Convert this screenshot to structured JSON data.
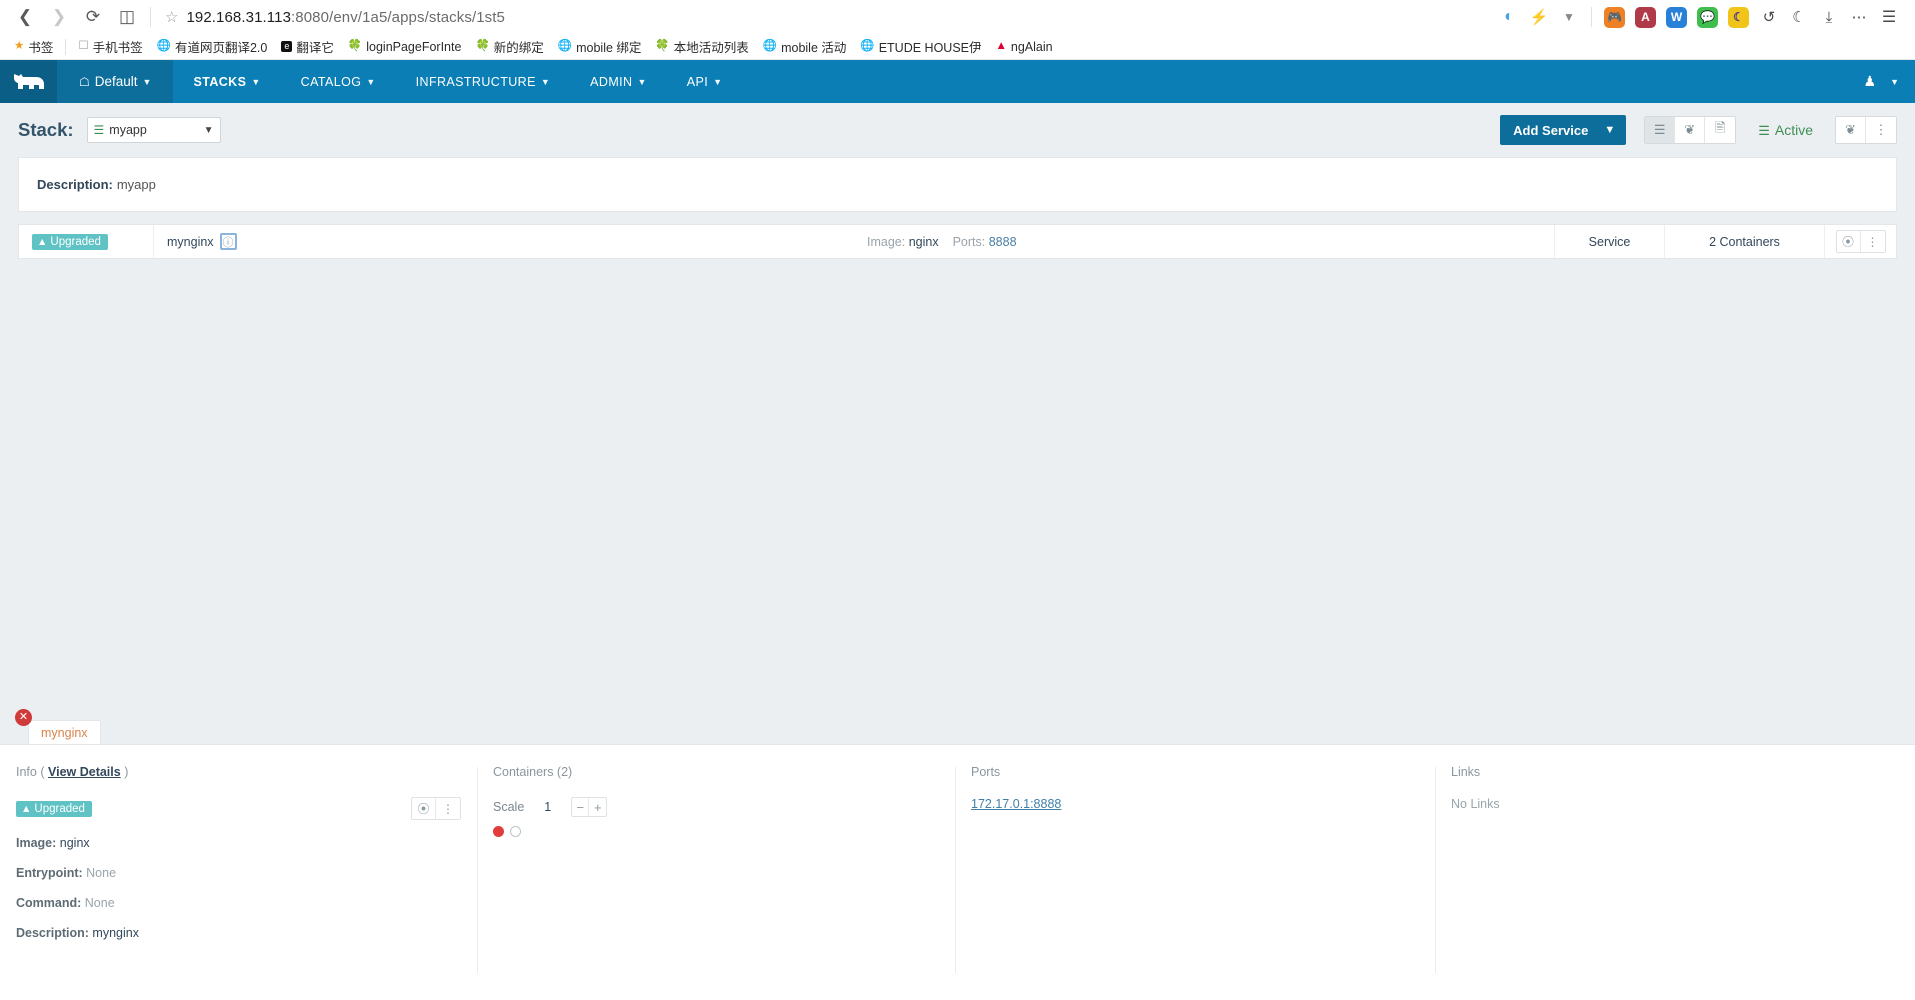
{
  "browser": {
    "nav": {
      "back_icon": "chevron-left",
      "forward_icon": "chevron-right",
      "reload_icon": "reload",
      "reader_icon": "book"
    },
    "url": {
      "host": "192.168.31.113",
      "rest": ":8080/env/1a5/apps/stacks/1st5",
      "star_icon": "star-outline"
    },
    "right_icons": [
      {
        "name": "sync-icon",
        "glyph": "◔",
        "color": "#4aa3df"
      },
      {
        "name": "lightning-icon",
        "glyph": "⚡",
        "color": "#555555"
      },
      {
        "name": "chevron-down-icon",
        "glyph": "⌄",
        "color": "#777777"
      },
      {
        "name": "gamepad-extension-icon",
        "glyph": "⬤",
        "color": "#ee8026",
        "label": ""
      },
      {
        "name": "adblock-extension-icon",
        "glyph": "A",
        "color": "#b03a48"
      },
      {
        "name": "youdao-extension-icon",
        "glyph": "W",
        "color": "#2980d9"
      },
      {
        "name": "wechat-extension-icon",
        "glyph": "●",
        "color": "#3fbe4d"
      },
      {
        "name": "moon-extension-icon",
        "glyph": "☾",
        "color": "#f0c418"
      },
      {
        "name": "undo-icon",
        "glyph": "↺",
        "color": "#444444"
      },
      {
        "name": "night-mode-icon",
        "glyph": "☾",
        "color": "#444444"
      },
      {
        "name": "download-icon",
        "glyph": "⤓",
        "color": "#444444"
      },
      {
        "name": "more-icon",
        "glyph": "⋯",
        "color": "#444444"
      },
      {
        "name": "menu-icon",
        "glyph": "☰",
        "color": "#444444"
      }
    ]
  },
  "bookmarks": [
    {
      "label": "书签",
      "icon": "star",
      "icon_class": "star"
    },
    {
      "label": "手机书签",
      "icon": "folder",
      "icon_class": "folder"
    },
    {
      "label": "有道网页翻译2.0",
      "icon": "globe",
      "icon_class": "globe"
    },
    {
      "label": "翻译它",
      "icon": "translate",
      "icon_class": "black"
    },
    {
      "label": "loginPageForInte",
      "icon": "leaf",
      "icon_class": "leaf"
    },
    {
      "label": "新的绑定",
      "icon": "leaf",
      "icon_class": "leaf"
    },
    {
      "label": "mobile 绑定",
      "icon": "globe",
      "icon_class": "globe"
    },
    {
      "label": "本地活动列表",
      "icon": "leaf",
      "icon_class": "leaf"
    },
    {
      "label": "mobile 活动",
      "icon": "globe",
      "icon_class": "globe"
    },
    {
      "label": "ETUDE HOUSE伊",
      "icon": "globe",
      "icon_class": "globe"
    },
    {
      "label": "ngAlain",
      "icon": "angular",
      "icon_class": "angular"
    }
  ],
  "rancher_nav": {
    "logo_name": "rancher-cow-logo",
    "environment": "Default",
    "items": [
      {
        "label": "STACKS",
        "active": true,
        "caret": true
      },
      {
        "label": "CATALOG",
        "active": false,
        "caret": true
      },
      {
        "label": "INFRASTRUCTURE",
        "active": false,
        "caret": true
      },
      {
        "label": "ADMIN",
        "active": false,
        "caret": true
      },
      {
        "label": "API",
        "active": false,
        "caret": true
      }
    ],
    "user_icon": "user-icon",
    "user_caret": "chevron-down-icon"
  },
  "stack_header": {
    "label": "Stack:",
    "selected_stack": "myapp",
    "add_service_label": "Add Service",
    "view_buttons": [
      {
        "name": "list-view-button",
        "glyph": "☰",
        "selected": true
      },
      {
        "name": "graph-view-button",
        "glyph": "⪤",
        "selected": false
      },
      {
        "name": "config-view-button",
        "glyph": "☷",
        "selected": false
      }
    ],
    "state_label": "Active",
    "right_buttons": [
      {
        "name": "share-button",
        "glyph": "⪤"
      },
      {
        "name": "overflow-menu-button",
        "glyph": "⋮"
      }
    ]
  },
  "description_card": {
    "label": "Description:",
    "value": "myapp"
  },
  "service_row": {
    "state_badge": "Upgraded",
    "name": "mynginx",
    "info_icon": "info-icon",
    "image_label": "Image:",
    "image_value": "nginx",
    "ports_label": "Ports:",
    "ports_value": "8888",
    "type": "Service",
    "containers": "2 Containers",
    "actions": [
      {
        "name": "activate-button",
        "glyph": "⊘"
      },
      {
        "name": "row-menu-button",
        "glyph": "⋮"
      }
    ]
  },
  "detail_panel": {
    "tab_label": "mynginx",
    "close_icon": "close-icon",
    "info": {
      "title_prefix": "Info (",
      "title_link": "View Details",
      "title_suffix": ")",
      "badge": "Upgraded",
      "actions": [
        {
          "name": "activate-button",
          "glyph": "⊘"
        },
        {
          "name": "detail-menu-button",
          "glyph": "⋮"
        }
      ],
      "rows": [
        {
          "label": "Image:",
          "value": "nginx"
        },
        {
          "label": "Entrypoint:",
          "value": "None"
        },
        {
          "label": "Command:",
          "value": "None"
        },
        {
          "label": "Description:",
          "value": "mynginx"
        }
      ]
    },
    "containers": {
      "title": "Containers (2)",
      "scale_label": "Scale",
      "scale_value": "1",
      "minus": "−",
      "plus": "+",
      "dots": [
        "red",
        "hollow"
      ]
    },
    "ports": {
      "title": "Ports",
      "value": "172.17.0.1:8888"
    },
    "links": {
      "title": "Links",
      "value": "No Links"
    }
  },
  "colors": {
    "nav_blue": "#0a7eb5",
    "accent_blue": "#0d6e9c",
    "badge_teal": "#5fc2c5",
    "active_green": "#3e8e54",
    "tab_orange": "#d9834a",
    "danger_red": "#cf3a3a"
  }
}
